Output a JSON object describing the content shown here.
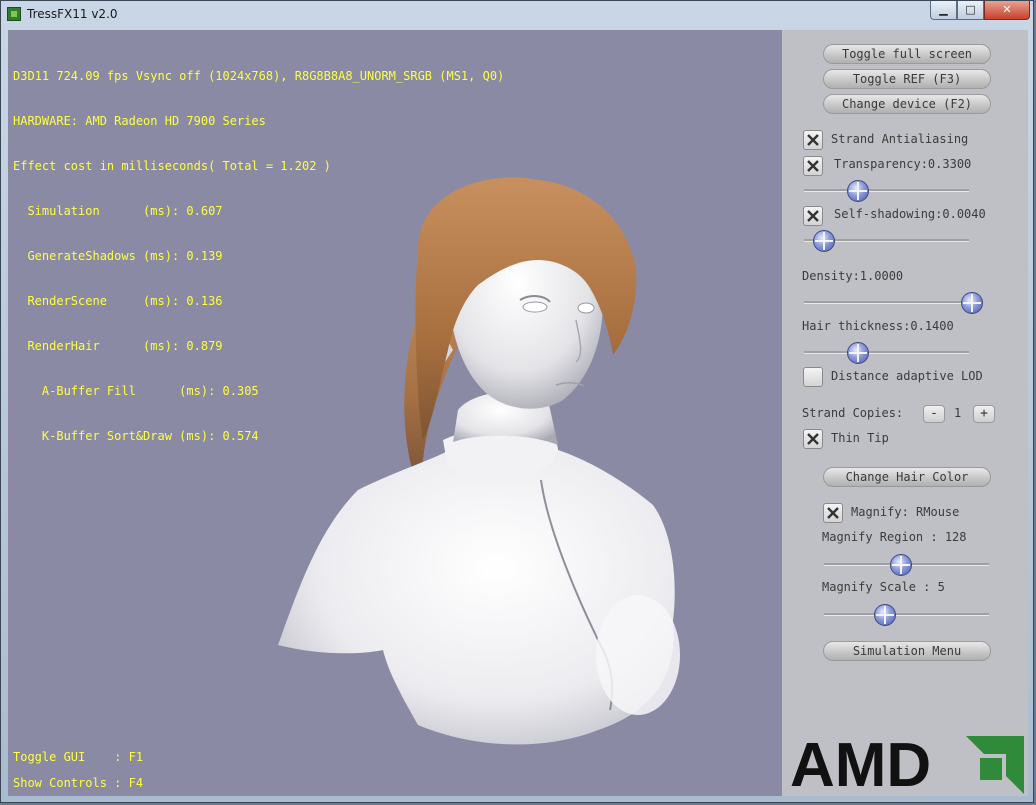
{
  "window": {
    "title": "TressFX11 v2.0",
    "controls": {
      "minimize": "▁",
      "maximize": "□",
      "close": "✕"
    }
  },
  "stats": {
    "lines": [
      "D3D11 724.09 fps Vsync off (1024x768), R8G8B8A8_UNORM_SRGB (MS1, Q0)",
      "HARDWARE: AMD Radeon HD 7900 Series",
      "Effect cost in milliseconds( Total = 1.202 )",
      "  Simulation      (ms): 0.607",
      "  GenerateShadows (ms): 0.139",
      "  RenderScene     (ms): 0.136",
      "  RenderHair      (ms): 0.879",
      "    A-Buffer Fill      (ms): 0.305",
      "    K-Buffer Sort&Draw (ms): 0.574"
    ]
  },
  "hints": {
    "toggle_gui": "Toggle GUI    : F1",
    "show_controls": "Show Controls : F4"
  },
  "panel": {
    "toggle_fullscreen": "Toggle full screen",
    "toggle_ref": "Toggle REF (F3)",
    "change_device": "Change device (F2)",
    "strand_aa": {
      "label": "Strand Antialiasing",
      "checked": true
    },
    "transparency": {
      "label": "Transparency:0.3300",
      "checked": true,
      "value": 0.33
    },
    "self_shadowing": {
      "label": "Self-shadowing:0.0040",
      "checked": true,
      "value": 0.004
    },
    "density": {
      "label": "Density:1.0000",
      "value": 1.0
    },
    "hair_thickness": {
      "label": "Hair thickness:0.1400",
      "value": 0.14
    },
    "distance_lod": {
      "label": "Distance adaptive LOD",
      "checked": false
    },
    "strand_copies": {
      "label": "Strand Copies:",
      "minus": "-",
      "value": "1",
      "plus": "+"
    },
    "thin_tip": {
      "label": "Thin Tip",
      "checked": true
    },
    "change_hair_color": "Change Hair Color",
    "magnify": {
      "label": "Magnify: RMouse",
      "checked": true
    },
    "magnify_region": {
      "label": "Magnify Region : 128",
      "value": 128
    },
    "magnify_scale": {
      "label": "Magnify Scale : 5",
      "value": 5
    },
    "simulation_menu": "Simulation Menu",
    "logo_text": "AMD"
  },
  "colors": {
    "overlay_text": "#ffff40",
    "viewport_bg": "#8a8aa5",
    "panel_bg": "#bfbfc6",
    "hair": "#b07a4e"
  }
}
